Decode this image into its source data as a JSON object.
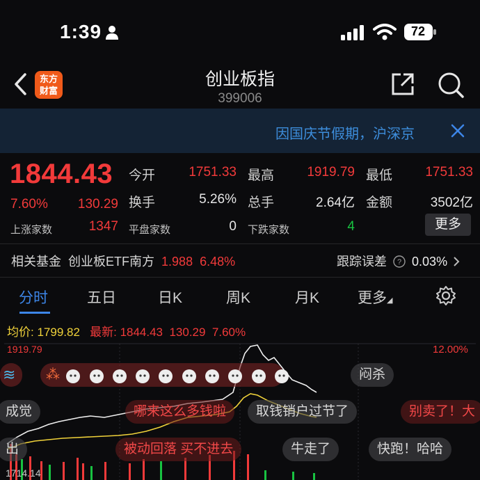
{
  "status_bar": {
    "time": "1:39",
    "battery": "72"
  },
  "header": {
    "title": "创业板指",
    "code": "399006",
    "logo_line1": "东方",
    "logo_line2": "财富"
  },
  "notice": {
    "text": "因国庆节假期，沪深京"
  },
  "quote": {
    "price": "1844.43",
    "change_pct": "7.60%",
    "change": "130.29",
    "open_label": "今开",
    "open": "1751.33",
    "high_label": "最高",
    "high": "1919.79",
    "low_label": "最低",
    "low": "1751.33",
    "turnover_label": "换手",
    "turnover": "5.26%",
    "volume_label": "总手",
    "volume": "2.64亿",
    "amount_label": "金额",
    "amount": "3502亿",
    "up_label": "上涨家数",
    "up_count": "1347",
    "flat_label": "平盘家数",
    "flat_count": "0",
    "down_label": "下跌家数",
    "down_count": "4",
    "more_label": "更多"
  },
  "fund": {
    "label": "相关基金",
    "name": "创业板ETF南方",
    "price": "1.988",
    "pct": "6.48%",
    "track_label": "跟踪误差",
    "track_value": "0.03%"
  },
  "tabs": [
    "分时",
    "五日",
    "日K",
    "周K",
    "月K",
    "更多"
  ],
  "chart": {
    "avg_label": "均价:",
    "avg_value": "1799.82",
    "latest_label": "最新:",
    "latest_value": "1844.43",
    "latest_change": "130.29",
    "latest_pct": "7.60%",
    "y_top": "1919.79",
    "pct_top": "12.00%",
    "time_mark": "1714.14"
  },
  "danmaku": [
    "闷杀",
    "成觉",
    "哪来这么多钱啦",
    "取钱销户过节了",
    "别卖了！大",
    "出",
    "被动回落 买不进去",
    "牛走了",
    "快跑！哈哈"
  ],
  "colors": {
    "up": "#f23a3a",
    "down": "#18c241",
    "accent": "#3d86e8",
    "avg": "#f0d23a"
  }
}
